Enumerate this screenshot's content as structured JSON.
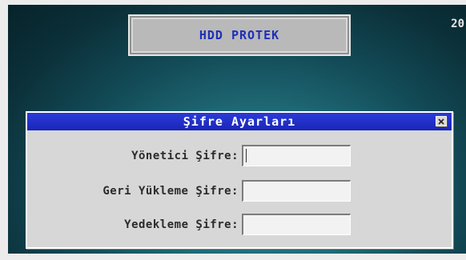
{
  "app": {
    "header_title": "HDD PROTEK",
    "corner_text": "20"
  },
  "dialog": {
    "title": "Şifre Ayarları",
    "close_icon": "close-icon",
    "fields": [
      {
        "label": "Yönetici Şifre:",
        "value": ""
      },
      {
        "label": "Geri Yükleme Şifre:",
        "value": ""
      },
      {
        "label": "Yedekleme Şifre:",
        "value": ""
      }
    ]
  },
  "colors": {
    "title_text": "#1e2fb8",
    "dialog_titlebar": "#2a3bd8",
    "background": "#1f6a76"
  }
}
